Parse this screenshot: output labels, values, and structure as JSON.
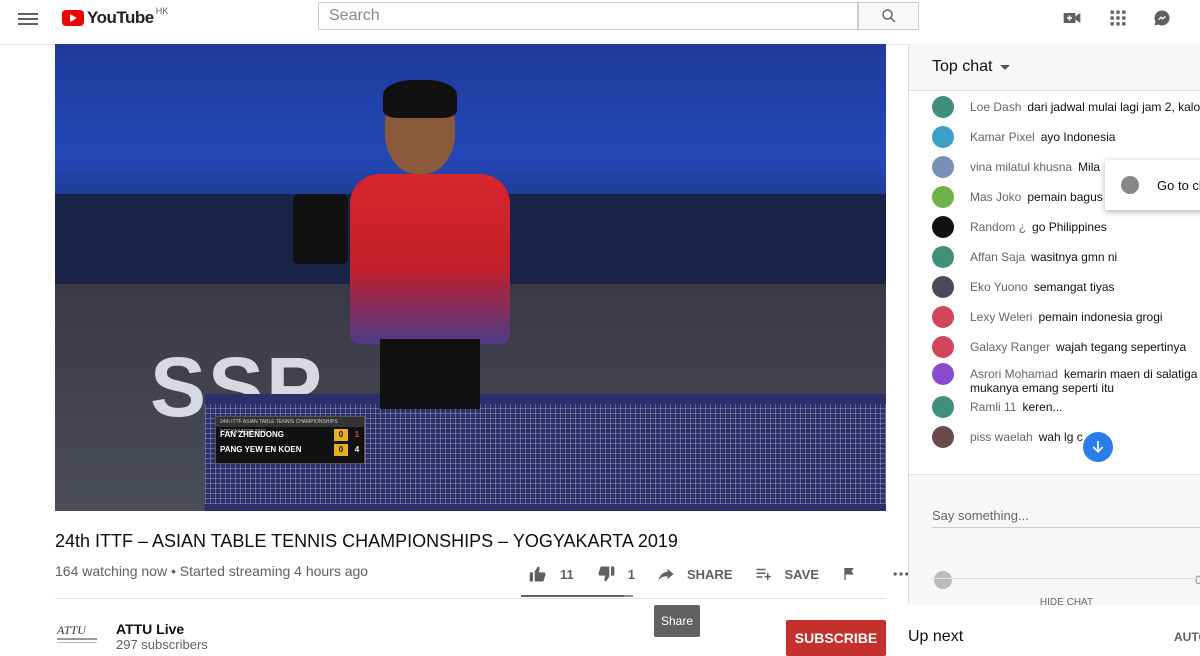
{
  "header": {
    "logo_text": "YouTube",
    "logo_region": "HK",
    "search_placeholder": "Search",
    "icons": [
      "menu-icon",
      "search-icon",
      "video-camera-icon",
      "apps-grid-icon",
      "messages-icon"
    ]
  },
  "video": {
    "title": "24th ITTF – ASIAN TABLE TENNIS CHAMPIONSHIPS – YOGYAKARTA 2019",
    "watching": "164 watching now",
    "started": "Started streaming 4 hours ago",
    "overlay_brand": "SSP",
    "scoreboard": {
      "header": "24th ITTF ASIAN TABLE TENNIS CHAMPIONSHIPS YOGYAKARTA 2019",
      "players": [
        {
          "name": "FAN ZHENDONG",
          "sets": "0",
          "points": "1"
        },
        {
          "name": "PANG YEW EN KOEN",
          "sets": "0",
          "points": "4"
        }
      ]
    }
  },
  "actions": {
    "likes": "11",
    "dislikes": "1",
    "share": "SHARE",
    "save": "SAVE",
    "like_ratio": 0.92
  },
  "channel": {
    "name": "ATTU Live",
    "subscribers": "297 subscribers",
    "logo_text": "ATTU",
    "subscribe_label": "SUBSCRIBE"
  },
  "tooltip": "Share",
  "chat": {
    "header": "Top chat",
    "messages": [
      {
        "author": "Loe Dash",
        "text": "dari jadwal mulai lagi jam 2, kalo",
        "color": "#3f8f7a"
      },
      {
        "author": "Kamar Pixel",
        "text": "ayo Indonesia",
        "color": "#3aa0c8"
      },
      {
        "author": "vina milatul khusna",
        "text": "Mila",
        "color": "#7a8fb8"
      },
      {
        "author": "Mas Joko",
        "text": "pemain bagus",
        "color": "#6fb04a"
      },
      {
        "author": "Random ¿",
        "text": "go Philippines",
        "color": "#111111"
      },
      {
        "author": "Affan Saja",
        "text": "wasitnya gmn ni",
        "color": "#3f8f7a"
      },
      {
        "author": "Eko Yuono",
        "text": "semangat tiyas",
        "color": "#4a4a5a"
      },
      {
        "author": "Lexy Weleri",
        "text": "pemain indonesia grogi",
        "color": "#d0455a"
      },
      {
        "author": "Galaxy Ranger",
        "text": "wajah tegang sepertinya",
        "color": "#d0455a"
      },
      {
        "author": "Asrori Mohamad",
        "text": "kemarin maen di salatiga",
        "text2": "mukanya emang seperti itu",
        "color": "#8a4ad0"
      },
      {
        "author": "Ramli 11",
        "text": "keren...",
        "color": "#3f8f7a"
      },
      {
        "author": "piss waelah",
        "text": "wah lg c",
        "color": "#6a4a4a"
      }
    ],
    "popup_label": "Go to cl",
    "input_placeholder": "Say something...",
    "char_count": "0",
    "hide_label": "HIDE CHAT"
  },
  "sidebar": {
    "up_next": "Up next",
    "autoplay": "AUTO"
  }
}
